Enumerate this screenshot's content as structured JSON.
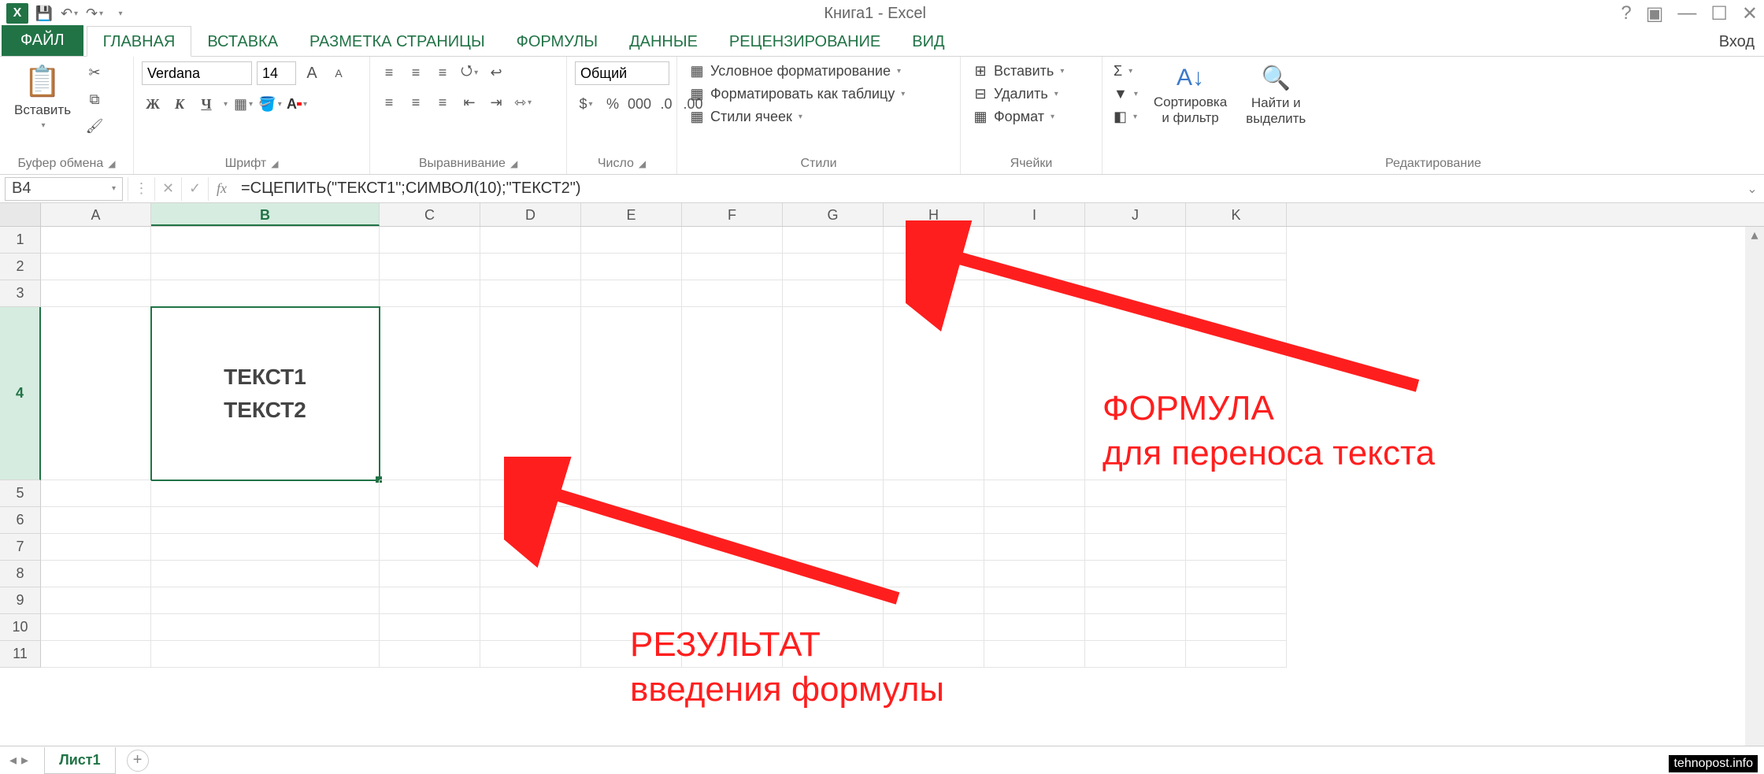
{
  "window": {
    "title": "Книга1 - Excel"
  },
  "qat": {
    "save": "save",
    "undo": "undo",
    "redo": "redo"
  },
  "tabs": {
    "file": "ФАЙЛ",
    "items": [
      "ГЛАВНАЯ",
      "ВСТАВКА",
      "РАЗМЕТКА СТРАНИЦЫ",
      "ФОРМУЛЫ",
      "ДАННЫЕ",
      "РЕЦЕНЗИРОВАНИЕ",
      "ВИД"
    ],
    "active": 0,
    "signin": "Вход"
  },
  "ribbon": {
    "clipboard": {
      "label": "Буфер обмена",
      "paste": "Вставить"
    },
    "font": {
      "label": "Шрифт",
      "name": "Verdana",
      "size": "14",
      "bold": "Ж",
      "italic": "К",
      "underline": "Ч",
      "grow": "A",
      "shrink": "A"
    },
    "alignment": {
      "label": "Выравнивание"
    },
    "number": {
      "label": "Число",
      "format": "Общий"
    },
    "styles": {
      "label": "Стили",
      "cond": "Условное форматирование",
      "table": "Форматировать как таблицу",
      "cell": "Стили ячеек"
    },
    "cells": {
      "label": "Ячейки",
      "insert": "Вставить",
      "delete": "Удалить",
      "format": "Формат"
    },
    "editing": {
      "label": "Редактирование",
      "sort": "Сортировка\nи фильтр",
      "find": "Найти и\nвыделить"
    }
  },
  "formula_bar": {
    "cell_ref": "B4",
    "formula": "=СЦЕПИТЬ(\"ТЕКСТ1\";СИМВОЛ(10);\"ТЕКСТ2\")"
  },
  "grid": {
    "columns": [
      "A",
      "B",
      "C",
      "D",
      "E",
      "F",
      "G",
      "H",
      "I",
      "J",
      "K"
    ],
    "rows": [
      1,
      2,
      3,
      4,
      5,
      6,
      7,
      8,
      9,
      10,
      11
    ],
    "active_cell": "B4",
    "b4_value": "ТЕКСТ1\nТЕКСТ2"
  },
  "sheet": {
    "name": "Лист1"
  },
  "annotations": {
    "a1_line1": "ФОРМУЛА",
    "a1_line2": "для переноса текста",
    "a2_line1": "РЕЗУЛЬТАТ",
    "a2_line2": "введения формулы"
  },
  "watermark": "tehnopost.info"
}
